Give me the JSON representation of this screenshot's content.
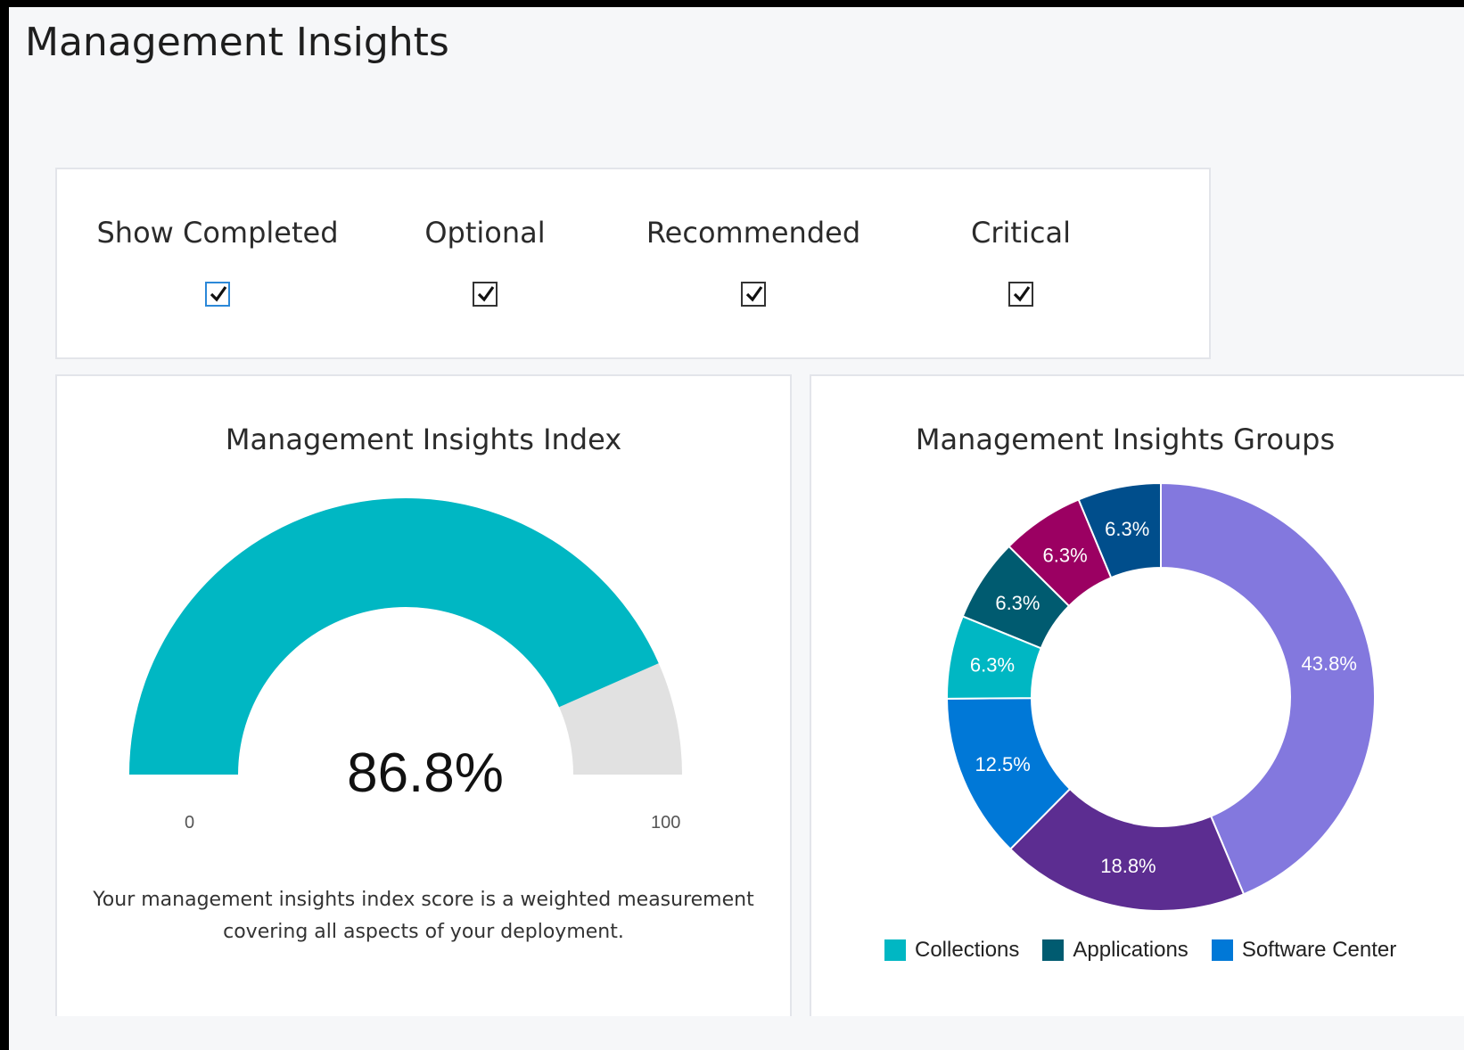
{
  "page": {
    "title": "Management Insights"
  },
  "filters": [
    {
      "label": "Show Completed",
      "checked": true,
      "focused": true
    },
    {
      "label": "Optional",
      "checked": true,
      "focused": false
    },
    {
      "label": "Recommended",
      "checked": true,
      "focused": false
    },
    {
      "label": "Critical",
      "checked": true,
      "focused": false
    }
  ],
  "index_card": {
    "title": "Management Insights Index",
    "value_label": "86.8%",
    "min_label": "0",
    "max_label": "100",
    "description": "Your management insights index score is a weighted measurement covering all aspects of your deployment."
  },
  "groups_card": {
    "title": "Management Insights Groups",
    "legend": [
      {
        "label": "Collections",
        "color": "#00b7c3"
      },
      {
        "label": "Applications",
        "color": "#005b70"
      },
      {
        "label": "Software Center",
        "color": "#0078d7"
      }
    ]
  },
  "chart_data": [
    {
      "type": "gauge",
      "value": 86.8,
      "min": 0,
      "max": 100,
      "value_label": "86.8%",
      "colors": {
        "fill": "#00b7c3",
        "track": "#e1e1e1"
      }
    },
    {
      "type": "pie",
      "donut": true,
      "title": "Management Insights Groups",
      "slices": [
        {
          "name": "",
          "value": 43.8,
          "label": "43.8%",
          "color": "#8378de"
        },
        {
          "name": "",
          "value": 18.8,
          "label": "18.8%",
          "color": "#5c2d91"
        },
        {
          "name": "Software Center",
          "value": 12.5,
          "label": "12.5%",
          "color": "#0078d7"
        },
        {
          "name": "Collections",
          "value": 6.3,
          "label": "6.3%",
          "color": "#00b7c3"
        },
        {
          "name": "Applications",
          "value": 6.3,
          "label": "6.3%",
          "color": "#005b70"
        },
        {
          "name": "",
          "value": 6.3,
          "label": "6.3%",
          "color": "#9b0062"
        },
        {
          "name": "",
          "value": 6.3,
          "label": "6.3%",
          "color": "#004e8c"
        }
      ]
    }
  ]
}
